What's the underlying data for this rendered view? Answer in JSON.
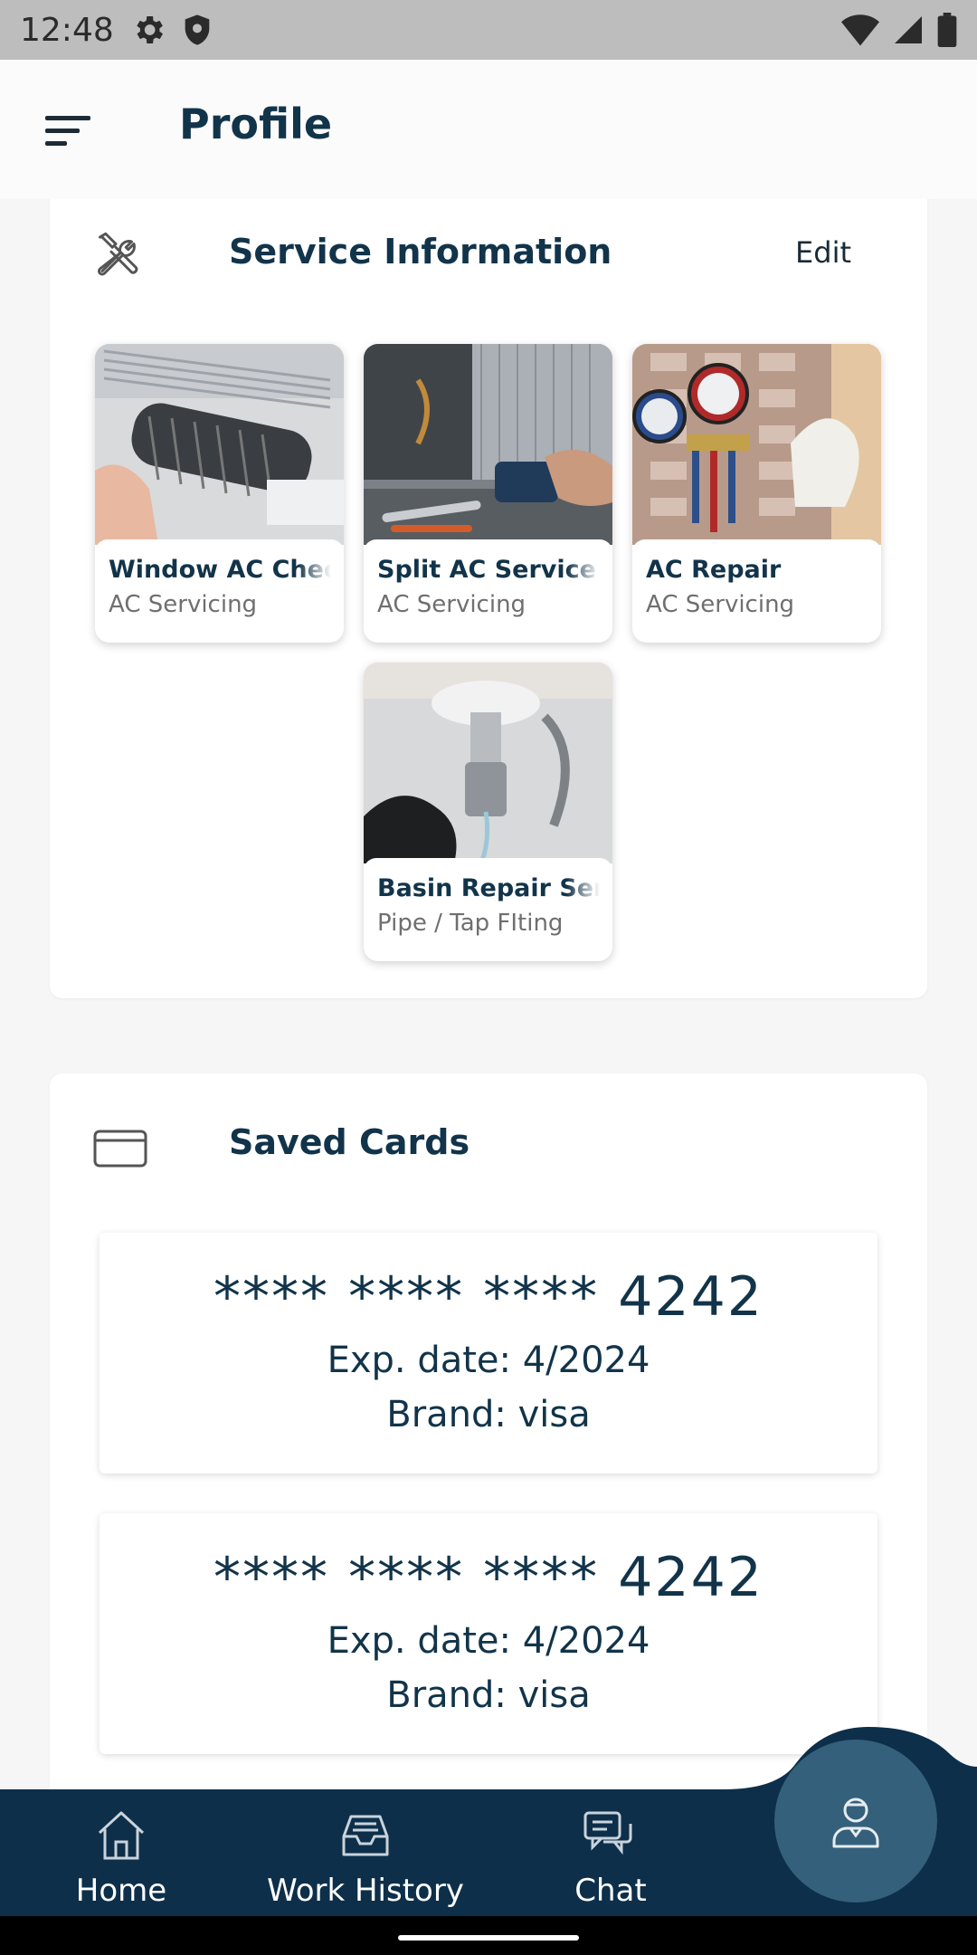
{
  "status_bar": {
    "time": "12:48",
    "icons_left": [
      "settings-icon",
      "shield-icon"
    ],
    "icons_right": [
      "wifi-icon",
      "signal-icon",
      "battery-icon"
    ]
  },
  "app_bar": {
    "title": "Profile",
    "menu_icon": "sort-menu-icon"
  },
  "service_section": {
    "title": "Service Information",
    "edit_label": "Edit",
    "icon": "tools-icon",
    "services": [
      {
        "name": "Window AC Checkup",
        "category": "AC Servicing",
        "image": "window-ac-photo"
      },
      {
        "name": "Split AC Service",
        "category": "AC Servicing",
        "image": "split-ac-photo"
      },
      {
        "name": "AC Repair",
        "category": "AC Servicing",
        "image": "ac-gauges-photo"
      },
      {
        "name": "Basin Repair Service",
        "category": "Pipe / Tap FIting",
        "image": "basin-tap-photo"
      }
    ]
  },
  "cards_section": {
    "title": "Saved Cards",
    "icon": "credit-card-icon",
    "cards": [
      {
        "number": "**** **** **** 4242",
        "exp": "Exp. date: 4/2024",
        "brand": "Brand: visa"
      },
      {
        "number": "**** **** **** 4242",
        "exp": "Exp. date: 4/2024",
        "brand": "Brand: visa"
      }
    ]
  },
  "bottom_nav": {
    "items": [
      {
        "label": "Home",
        "icon": "home-icon"
      },
      {
        "label": "Work History",
        "icon": "inbox-tray-icon"
      },
      {
        "label": "Chat",
        "icon": "chat-bubbles-icon"
      }
    ],
    "fab_icon": "profile-person-icon"
  },
  "colors": {
    "primary_dark": "#0d2f4a",
    "fab": "#34607b",
    "text_dark": "#12344a",
    "background": "#f6f6f6"
  }
}
